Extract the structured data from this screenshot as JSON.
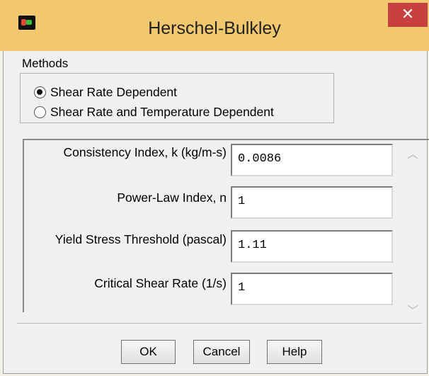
{
  "window": {
    "title": "Herschel-Bulkley",
    "close_glyph": "✕",
    "app_icon": "app-logo-icon"
  },
  "methods": {
    "label": "Methods",
    "options": [
      {
        "label": "Shear Rate Dependent",
        "checked": true
      },
      {
        "label": "Shear Rate and Temperature Dependent",
        "checked": false
      }
    ]
  },
  "params": [
    {
      "label": "Consistency Index, k (kg/m-s)",
      "value": "0.0086"
    },
    {
      "label": "Power-Law Index, n",
      "value": "1"
    },
    {
      "label": "Yield Stress Threshold (pascal)",
      "value": "1.11"
    },
    {
      "label": "Critical Shear Rate (1/s)",
      "value": "1"
    }
  ],
  "scroll": {
    "up_glyph": "︿",
    "down_glyph": "﹀"
  },
  "buttons": {
    "ok": "OK",
    "cancel": "Cancel",
    "help": "Help"
  }
}
